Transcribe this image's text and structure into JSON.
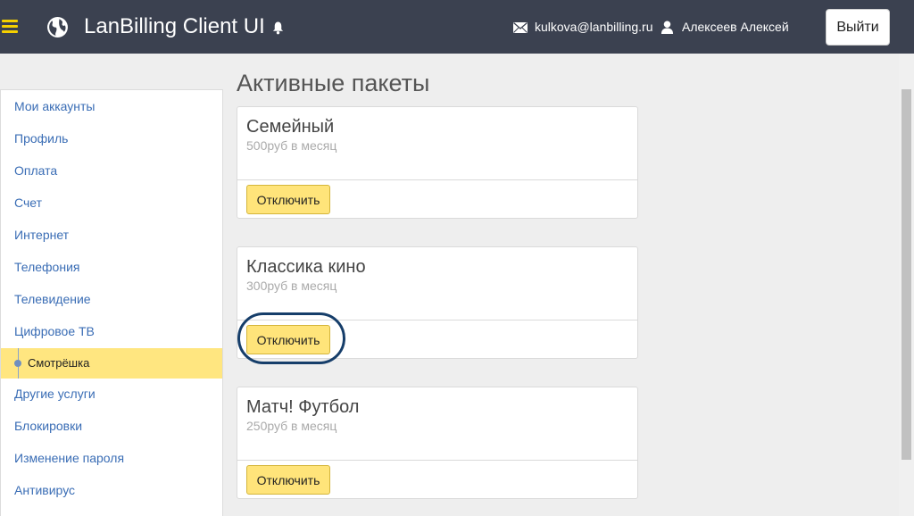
{
  "header": {
    "title": "LanBilling Client UI",
    "email": "kulkova@lanbilling.ru",
    "user_name": "Алексеев Алексей",
    "logout_label": "Выйти",
    "icons": [
      "menu-icon",
      "globe-icon",
      "bell-icon",
      "mail-icon",
      "user-icon"
    ]
  },
  "sidebar": {
    "items": [
      {
        "label": "Мои аккаунты"
      },
      {
        "label": "Профиль"
      },
      {
        "label": "Оплата"
      },
      {
        "label": "Счет"
      },
      {
        "label": "Интернет"
      },
      {
        "label": "Телефония"
      },
      {
        "label": "Телевидение"
      },
      {
        "label": "Цифровое ТВ"
      },
      {
        "label": "Смотрёшка",
        "active": true
      },
      {
        "label": "Другие услуги"
      },
      {
        "label": "Блокировки"
      },
      {
        "label": "Изменение пароля"
      },
      {
        "label": "Антивирус"
      }
    ]
  },
  "main": {
    "title": "Активные пакеты",
    "packages": [
      {
        "name": "Семейный",
        "price": "500руб в месяц",
        "button": "Отключить"
      },
      {
        "name": "Классика кино",
        "price": "300руб в месяц",
        "button": "Отключить"
      },
      {
        "name": "Матч! Футбол",
        "price": "250руб в месяц",
        "button": "Отключить"
      }
    ]
  },
  "colors": {
    "header_bg": "#3b4150",
    "accent_yellow": "#ffe47a",
    "link_blue": "#3a6db5",
    "highlight_ring": "#163e6a"
  }
}
